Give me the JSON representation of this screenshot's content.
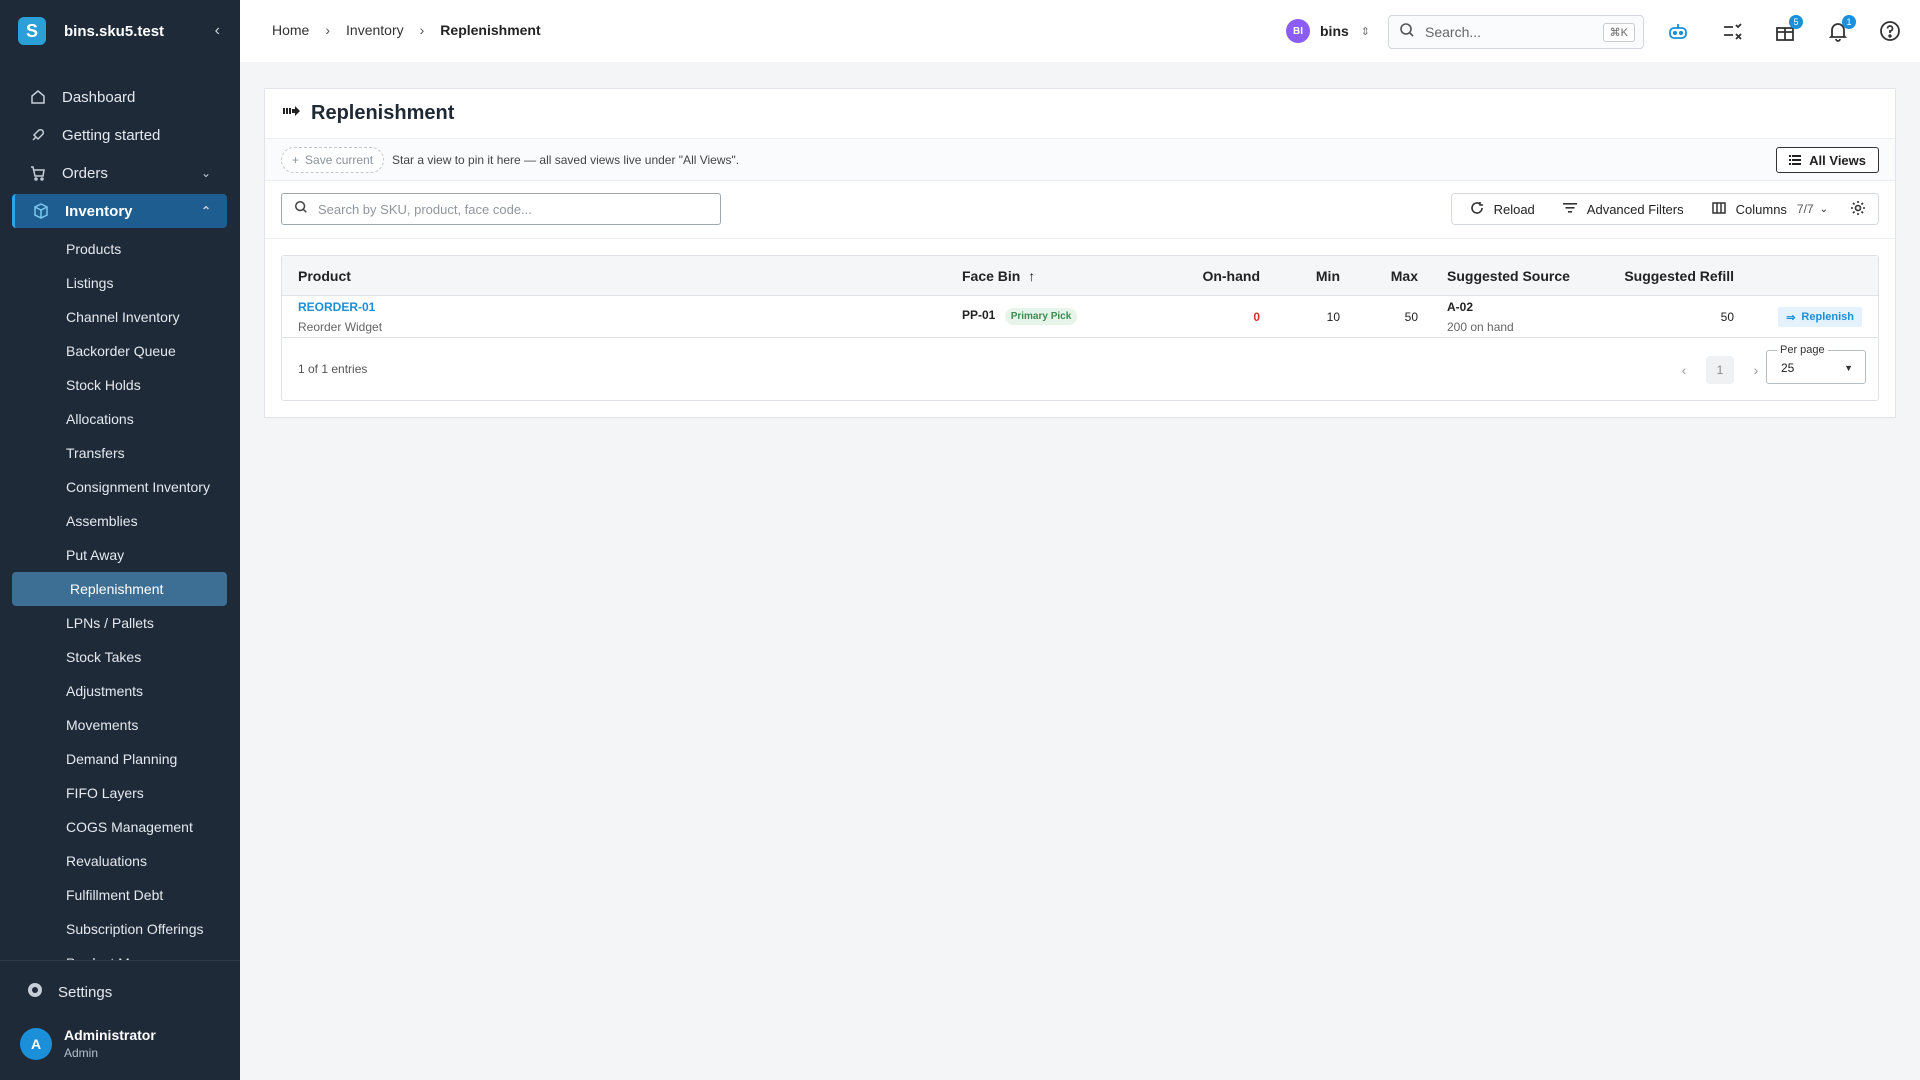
{
  "app": {
    "store_name": "bins.sku5.test",
    "logo_letter": "S"
  },
  "sidebar": {
    "items": [
      {
        "label": "Dashboard"
      },
      {
        "label": "Getting started"
      },
      {
        "label": "Orders"
      },
      {
        "label": "Inventory"
      }
    ],
    "inventory_sub": [
      "Products",
      "Listings",
      "Channel Inventory",
      "Backorder Queue",
      "Stock Holds",
      "Allocations",
      "Transfers",
      "Consignment Inventory",
      "Assemblies",
      "Put Away",
      "Replenishment",
      "LPNs / Pallets",
      "Stock Takes",
      "Adjustments",
      "Movements",
      "Demand Planning",
      "FIFO Layers",
      "COGS Management",
      "Revaluations",
      "Fulfillment Debt",
      "Subscription Offerings",
      "Product Menus"
    ],
    "settings_label": "Settings",
    "user": {
      "initial": "A",
      "name": "Administrator",
      "role": "Admin"
    }
  },
  "topbar": {
    "breadcrumb": [
      "Home",
      "Inventory",
      "Replenishment"
    ],
    "tenant": {
      "initials": "BI",
      "name": "bins"
    },
    "search": {
      "placeholder": "Search...",
      "shortcut": "⌘K"
    },
    "gift_badge": "5",
    "notification_badge": "1"
  },
  "page": {
    "title": "Replenishment",
    "views": {
      "save_current": "Save current",
      "hint": "Star a view to pin it here — all saved views live under \"All Views\".",
      "all_views": "All Views"
    },
    "toolbar": {
      "search_placeholder": "Search by SKU, product, face code...",
      "reload": "Reload",
      "advanced_filters": "Advanced Filters",
      "columns": "Columns",
      "columns_count": "7/7"
    },
    "table": {
      "headers": {
        "product": "Product",
        "face_bin": "Face Bin",
        "on_hand": "On-hand",
        "min": "Min",
        "max": "Max",
        "source": "Suggested Source",
        "refill": "Suggested Refill"
      },
      "rows": [
        {
          "sku": "REORDER-01",
          "name": "Reorder Widget",
          "face_bin": "PP-01",
          "bin_tag": "Primary Pick",
          "on_hand": "0",
          "min": "10",
          "max": "50",
          "source_bin": "A-02",
          "source_qty": "200 on hand",
          "refill": "50",
          "action": "Replenish"
        }
      ]
    },
    "footer": {
      "entries": "1 of 1 entries",
      "current_page": "1",
      "per_page_label": "Per page",
      "per_page_value": "25"
    }
  },
  "colors": {
    "sidebar_bg": "#1e2a38",
    "accent": "#1b8fd8",
    "active_nav": "#1d5d8f",
    "alert_red": "#d32f2f"
  }
}
